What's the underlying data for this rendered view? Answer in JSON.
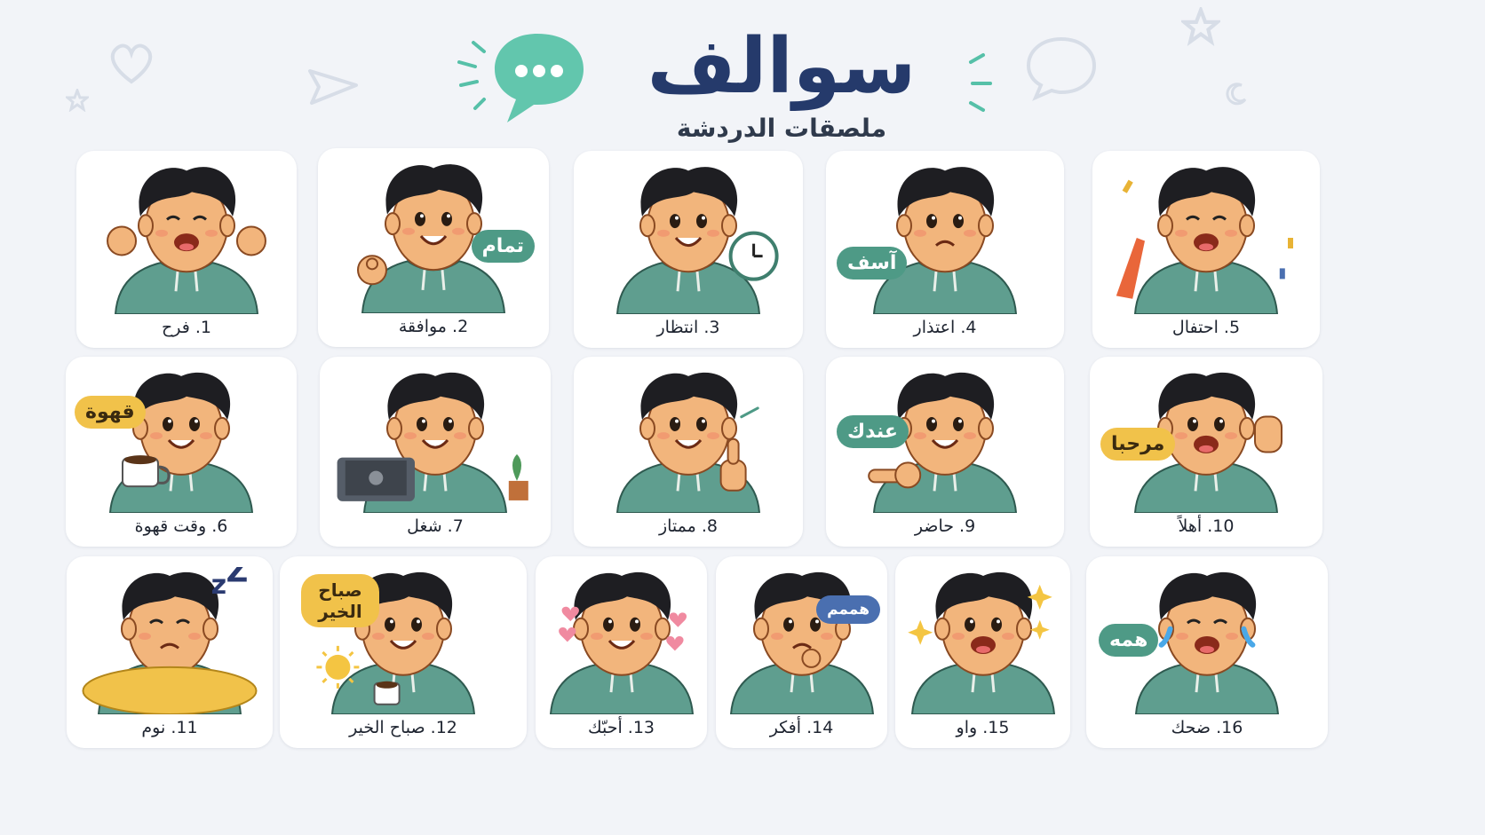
{
  "header": {
    "title": "سوالف",
    "subtitle": "ملصقات الدردشة"
  },
  "colors": {
    "hoodie": "#5f9e8f",
    "hair": "#1e1e22",
    "skin": "#f2b57c",
    "accent_teal": "#4e9a86",
    "accent_yellow": "#f1c24a",
    "title_navy": "#253a6b",
    "background": "#f2f4f8"
  },
  "stickers": [
    {
      "label": "1. فرح",
      "bubble": "",
      "icon": "celebrate-arms-icon"
    },
    {
      "label": "2. موافقة",
      "bubble": "تمام",
      "icon": "ok-hand-icon"
    },
    {
      "label": "3. انتظار",
      "bubble": "",
      "icon": "clock-icon"
    },
    {
      "label": "4. اعتذار",
      "bubble": "آسف",
      "icon": "praying-hands-icon"
    },
    {
      "label": "5. احتفال",
      "bubble": "",
      "icon": "party-popper-icon"
    },
    {
      "label": "6. وقت قهوة",
      "bubble": "قهوة",
      "icon": "coffee-cup-icon"
    },
    {
      "label": "7. شغل",
      "bubble": "",
      "icon": "laptop-icon"
    },
    {
      "label": "8. ممتاز",
      "bubble": "",
      "icon": "thumbs-up-icon"
    },
    {
      "label": "9. حاضر",
      "bubble": "عندك",
      "icon": "pointing-hand-icon"
    },
    {
      "label": "10. أهلاً",
      "bubble": "مرحبا",
      "icon": "waving-hand-icon"
    },
    {
      "label": "11. نوم",
      "bubble": "",
      "icon": "zzz-icon"
    },
    {
      "label": "12. صباح الخير",
      "bubble": "صباح الخير",
      "icon": "sun-icon"
    },
    {
      "label": "13. أحبّك",
      "bubble": "",
      "icon": "heart-hands-icon"
    },
    {
      "label": "14. أفكر",
      "bubble": "هممم",
      "icon": "thinking-icon"
    },
    {
      "label": "15. واو",
      "bubble": "",
      "icon": "sparkle-icon"
    },
    {
      "label": "16. ضحك",
      "bubble": "همه",
      "icon": "tears-of-joy-icon"
    }
  ]
}
